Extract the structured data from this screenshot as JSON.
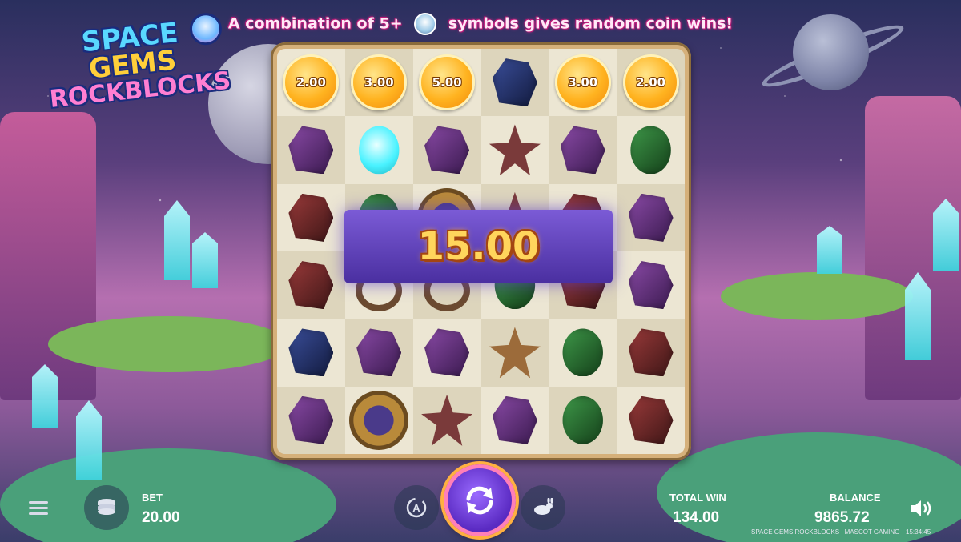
{
  "banner": {
    "text_before": "A combination of 5+",
    "text_after": "symbols gives random coin wins!",
    "icon": "astronaut-icon"
  },
  "logo": {
    "line1": "SPACE",
    "line2": "GEMS",
    "line3": "ROCKBLOCKS"
  },
  "grid": {
    "rows": [
      [
        {
          "type": "coin",
          "value": "2.00"
        },
        {
          "type": "coin",
          "value": "3.00"
        },
        {
          "type": "coin",
          "value": "5.00"
        },
        {
          "type": "gem",
          "color": "blue"
        },
        {
          "type": "coin",
          "value": "3.00"
        },
        {
          "type": "coin",
          "value": "2.00"
        }
      ],
      [
        {
          "type": "gem",
          "color": "purple"
        },
        {
          "type": "gem",
          "color": "cyan"
        },
        {
          "type": "gem",
          "color": "purple"
        },
        {
          "type": "star",
          "color": "red"
        },
        {
          "type": "gem",
          "color": "purple"
        },
        {
          "type": "gem",
          "color": "green"
        }
      ],
      [
        {
          "type": "gem",
          "color": "red"
        },
        {
          "type": "gem",
          "color": "green"
        },
        {
          "type": "sun"
        },
        {
          "type": "star",
          "color": "red"
        },
        {
          "type": "gem",
          "color": "red"
        },
        {
          "type": "gem",
          "color": "purple"
        }
      ],
      [
        {
          "type": "gem",
          "color": "red"
        },
        {
          "type": "ring"
        },
        {
          "type": "ring"
        },
        {
          "type": "gem",
          "color": "green"
        },
        {
          "type": "gem",
          "color": "red"
        },
        {
          "type": "gem",
          "color": "purple"
        }
      ],
      [
        {
          "type": "gem",
          "color": "blue"
        },
        {
          "type": "gem",
          "color": "purple"
        },
        {
          "type": "gem",
          "color": "purple"
        },
        {
          "type": "star",
          "color": "brown"
        },
        {
          "type": "gem",
          "color": "green"
        },
        {
          "type": "gem",
          "color": "red"
        }
      ],
      [
        {
          "type": "gem",
          "color": "purple"
        },
        {
          "type": "sun"
        },
        {
          "type": "star",
          "color": "red"
        },
        {
          "type": "gem",
          "color": "purple"
        },
        {
          "type": "gem",
          "color": "green"
        },
        {
          "type": "gem",
          "color": "red"
        }
      ]
    ]
  },
  "win": {
    "amount": "15.00"
  },
  "controls": {
    "bet_label": "BET",
    "bet_value": "20.00",
    "total_win_label": "TOTAL WIN",
    "total_win_value": "134.00",
    "balance_label": "BALANCE",
    "balance_value": "9865.72",
    "footer": "SPACE GEMS ROCKBLOCKS | MASCOT GAMING",
    "clock": "15:34:45"
  },
  "colors": {
    "accent": "#7b5bd6",
    "coin": "#ffb320",
    "win_text": "#ffd55c",
    "banner_text": "#ffe9f7"
  }
}
